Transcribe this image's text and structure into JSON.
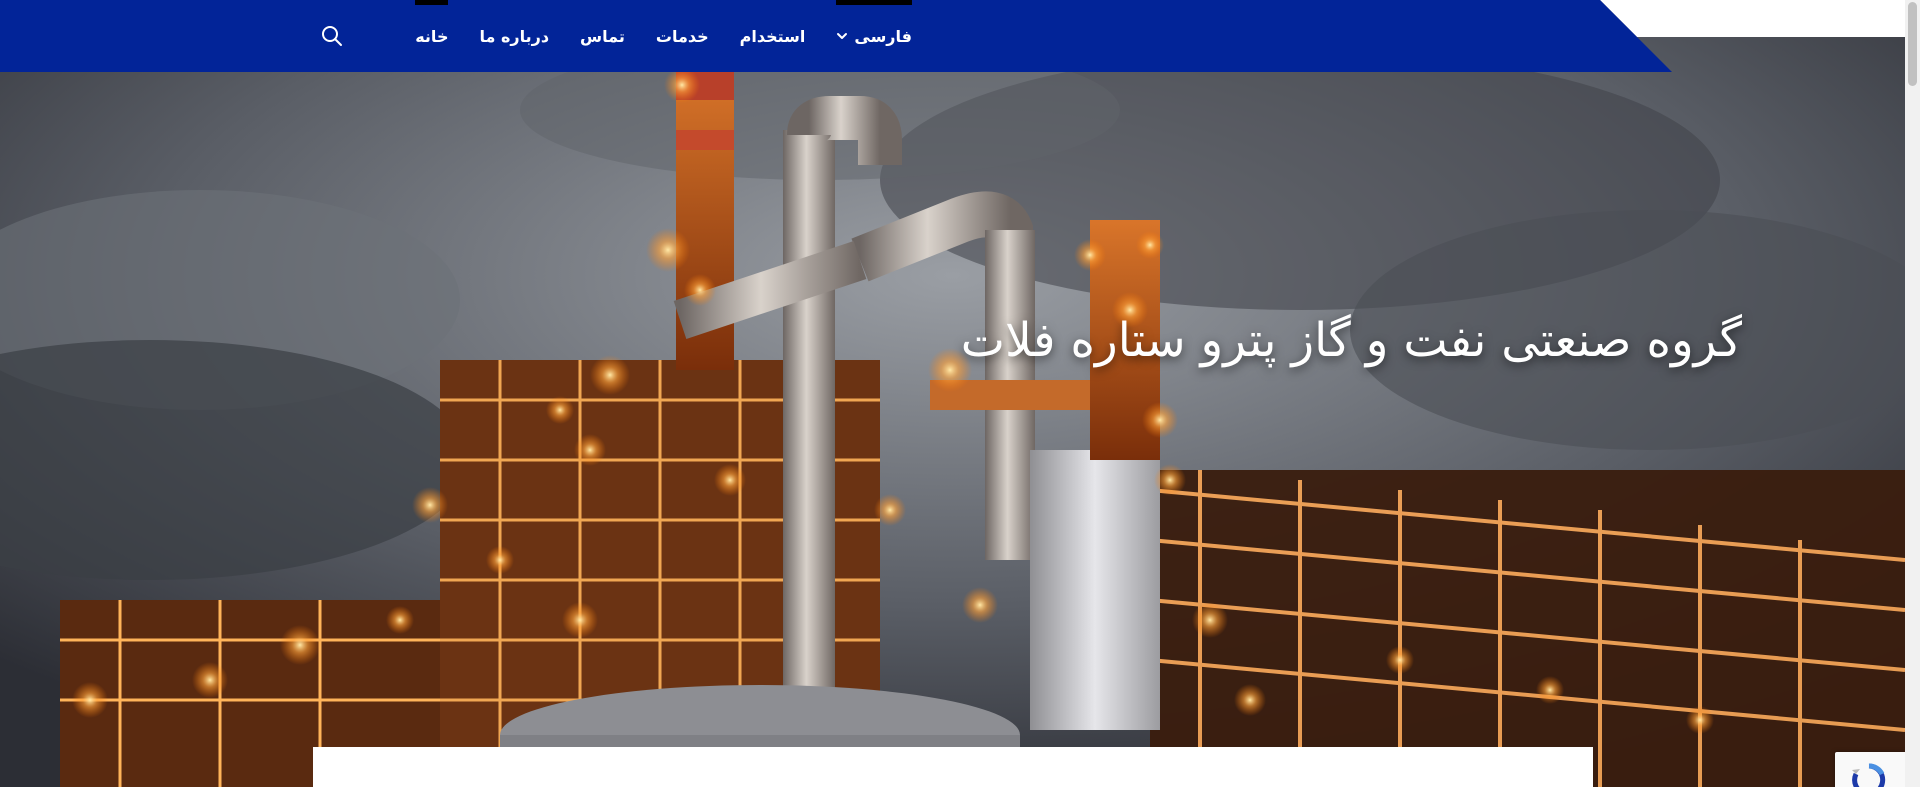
{
  "nav": {
    "items": [
      {
        "label": "خانه",
        "active": true
      },
      {
        "label": "درباره ما",
        "active": false
      },
      {
        "label": "تماس",
        "active": false
      },
      {
        "label": "خدمات",
        "active": false
      },
      {
        "label": "استخدام",
        "active": false
      },
      {
        "label": "فارسی",
        "active": true,
        "dropdown": true
      }
    ],
    "search_icon": "search-icon"
  },
  "hero": {
    "title": "گروه صنعتی نفت و گاز پترو ستاره فلات"
  },
  "colors": {
    "nav_bg": "#022498",
    "active_indicator": "#000000",
    "text": "#ffffff"
  }
}
